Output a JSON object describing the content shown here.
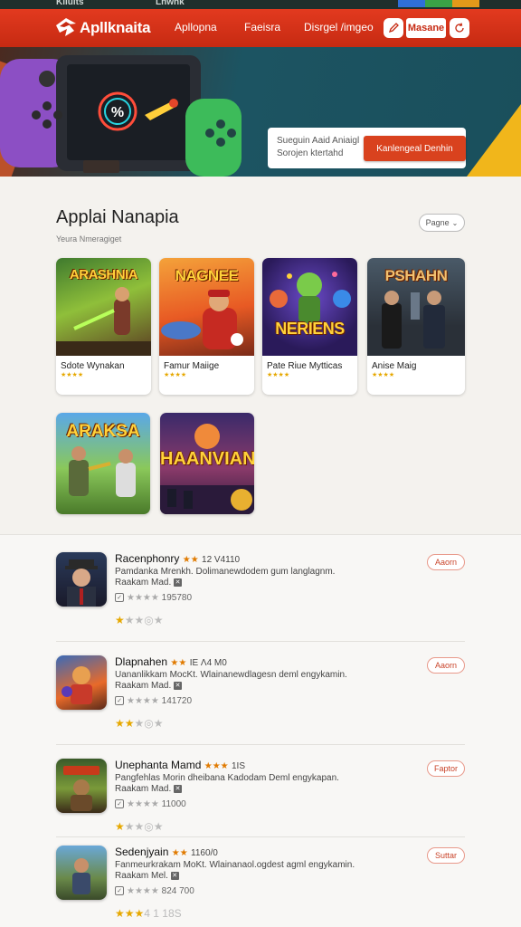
{
  "topbar": {
    "label_left": "Kiluits",
    "label_mid": "Lnwhk"
  },
  "header": {
    "brand": "Apllknaita",
    "nav": [
      "Apllopna",
      "Faeisra",
      "Disrgel /imgeo"
    ],
    "button_label": "Masane"
  },
  "hero": {
    "search_placeholder_1": "Sueguin Aaid Aniaigl",
    "search_placeholder_2": "Sorojen ktertahd",
    "cta_label": "Kanlengeal Denhin"
  },
  "section": {
    "title": "Applai Nanapia",
    "subtitle": "Yeura Nmeragiget",
    "sort_label": "Pagne"
  },
  "cards": [
    {
      "name": "Sdote Wynakan",
      "art_title": "ARASHNIA",
      "stars": "★★★★"
    },
    {
      "name": "Famur Maiige",
      "art_title": "NAGNEE",
      "stars": "★★★★"
    },
    {
      "name": "Pate Riue Mytticas",
      "art_title": "NERIENS",
      "stars": "★★★★"
    },
    {
      "name": "Anise Maig",
      "art_title": "PSHAHN",
      "stars": "★★★★"
    }
  ],
  "tiles": [
    {
      "art_title": "ARAKSA"
    },
    {
      "art_title": "HAANVIAN"
    }
  ],
  "list": [
    {
      "title": "Racenphonry",
      "title_stars": "★★",
      "title_num": "12 V4110",
      "desc": "Pamdanka Mrenkh. Dolimanewdodem gum langlagnm. Raakam Mad.",
      "meta_stars": "★★★★",
      "meta_num": "195780",
      "rating": "★",
      "rating_rest": "★★◎★",
      "pill": "Aaorn"
    },
    {
      "title": "Dlapnahen",
      "title_stars": "★★",
      "title_num": "IE Λ4 M0",
      "desc": "Uananlikkam MocKt. Wlainanewdlagesn deml engykamin. Raakam Mad.",
      "meta_stars": "★★★★",
      "meta_num": "141720",
      "rating": "★★",
      "rating_rest": "★◎★",
      "pill": "Aaorn"
    },
    {
      "title": "Unephanta Mamd",
      "title_stars": "★★★",
      "title_num": "1IS",
      "desc": "Pangfehlas Morin dheibana Kadodam Deml engykapan. Raakam Mad.",
      "meta_stars": "★★★★",
      "meta_num": "11000",
      "rating": "★",
      "rating_rest": "★★◎★",
      "pill": "Faptor"
    },
    {
      "title": "Sedenjyain",
      "title_stars": "★★",
      "title_num": "1160/0",
      "desc": "Fanmeurkrakam MoKt. Wlainanaol.ogdest agml engykamin. Raakam Mel.",
      "meta_stars": "★★★★",
      "meta_num": "824 700",
      "rating": "★★★",
      "rating_rest": "4 1 18S",
      "pill": "Suttar"
    }
  ],
  "colors": {
    "brand_red": "#d9421e",
    "accent_yellow": "#e6a800"
  }
}
